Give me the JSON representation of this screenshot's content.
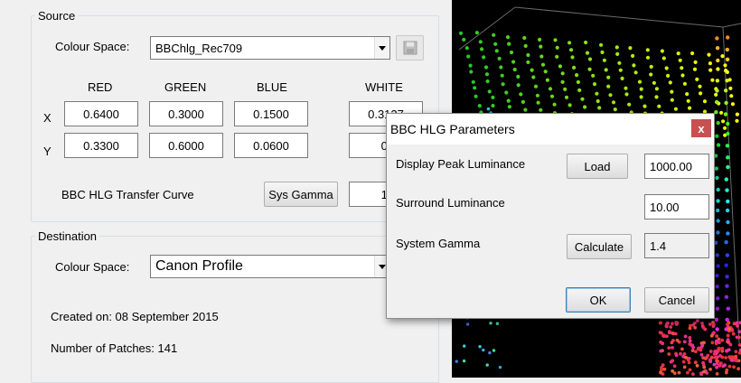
{
  "source": {
    "legend": "Source",
    "colour_space_label": "Colour Space:",
    "colour_space_value": "BBChlg_Rec709",
    "col_red": "RED",
    "col_green": "GREEN",
    "col_blue": "BLUE",
    "col_white": "WHITE",
    "row_x": "X",
    "row_y": "Y",
    "x_red": "0.6400",
    "x_green": "0.3000",
    "x_blue": "0.1500",
    "x_white": "0.3127",
    "y_red": "0.3300",
    "y_green": "0.6000",
    "y_blue": "0.0600",
    "y_white": "0.",
    "transfer_label": "BBC HLG Transfer Curve",
    "sys_gamma_button": "Sys Gamma",
    "transfer_value": "1."
  },
  "destination": {
    "legend": "Destination",
    "colour_space_label": "Colour Space:",
    "colour_space_value": "Canon Profile",
    "created_on": "Created on: 08 September 2015",
    "patches": "Number of Patches: 141"
  },
  "dialog": {
    "title": "BBC HLG Parameters",
    "close_glyph": "x",
    "peak_label": "Display Peak Luminance",
    "load_button": "Load",
    "peak_value": "1000.00",
    "surround_label": "Surround Luminance",
    "surround_value": "10.00",
    "gamma_label": "System Gamma",
    "calculate_button": "Calculate",
    "gamma_value": "1.4",
    "ok_button": "OK",
    "cancel_button": "Cancel"
  }
}
